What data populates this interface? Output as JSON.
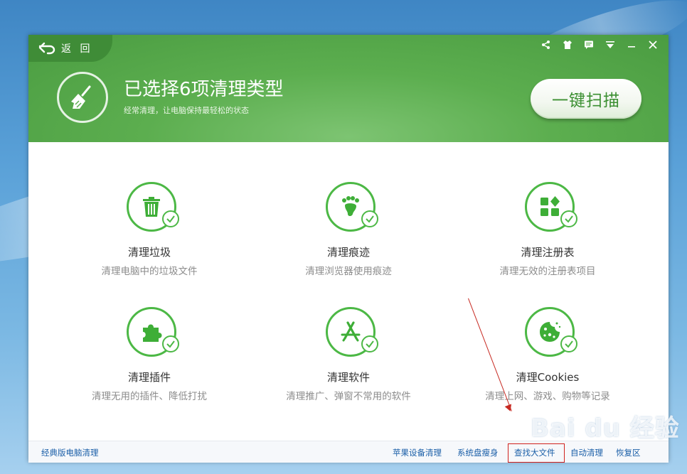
{
  "header": {
    "back_label": "返 回",
    "title": "已选择6项清理类型",
    "subtitle": "经常清理，让电脑保持最轻松的状态",
    "scan_button": "一键扫描",
    "controls": [
      "share-icon",
      "skin-icon",
      "message-icon",
      "menu-icon",
      "minimize-icon",
      "close-icon"
    ]
  },
  "items": [
    {
      "title": "清理垃圾",
      "desc": "清理电脑中的垃圾文件",
      "icon": "trash-icon"
    },
    {
      "title": "清理痕迹",
      "desc": "清理浏览器使用痕迹",
      "icon": "footprint-icon"
    },
    {
      "title": "清理注册表",
      "desc": "清理无效的注册表项目",
      "icon": "registry-icon"
    },
    {
      "title": "清理插件",
      "desc": "清理无用的插件、降低打扰",
      "icon": "puzzle-icon"
    },
    {
      "title": "清理软件",
      "desc": "清理推广、弹窗不常用的软件",
      "icon": "app-store-icon"
    },
    {
      "title": "清理Cookies",
      "desc": "清理上网、游戏、购物等记录",
      "icon": "cookie-icon"
    }
  ],
  "footer": {
    "classic": "经典版电脑清理",
    "links": [
      "苹果设备清理",
      "系统盘瘦身",
      "查找大文件",
      "自动清理",
      "恢复区"
    ]
  },
  "watermark": "Bai du 经验",
  "colors": {
    "brand_green": "#4cb845",
    "header_green": "#5cae4f",
    "link_blue": "#1b5fa8",
    "annotation_red": "#d0221e"
  }
}
